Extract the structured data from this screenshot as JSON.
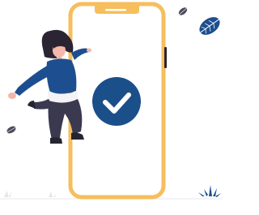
{
  "illustration": {
    "subject": "person-jumping-beside-phone",
    "icons": [
      "phone-icon",
      "check-icon",
      "leaf-icon",
      "plant-icon"
    ]
  },
  "colors": {
    "phone_frame": "#f6be5c",
    "phone_screen": "#ffffff",
    "notch": "#f6be5c",
    "check_circle": "#1b4f8a",
    "check_mark": "#ffffff",
    "shirt": "#1d4f90",
    "pants": "#3b3950",
    "hair": "#2b2432",
    "skin": "#f5b7a8",
    "shoe": "#252532",
    "leaf": "#1c4f8d",
    "leaf_gray": "#4b4a5a",
    "ground": "#e8e8ee",
    "plant": "#1c4f8d"
  }
}
